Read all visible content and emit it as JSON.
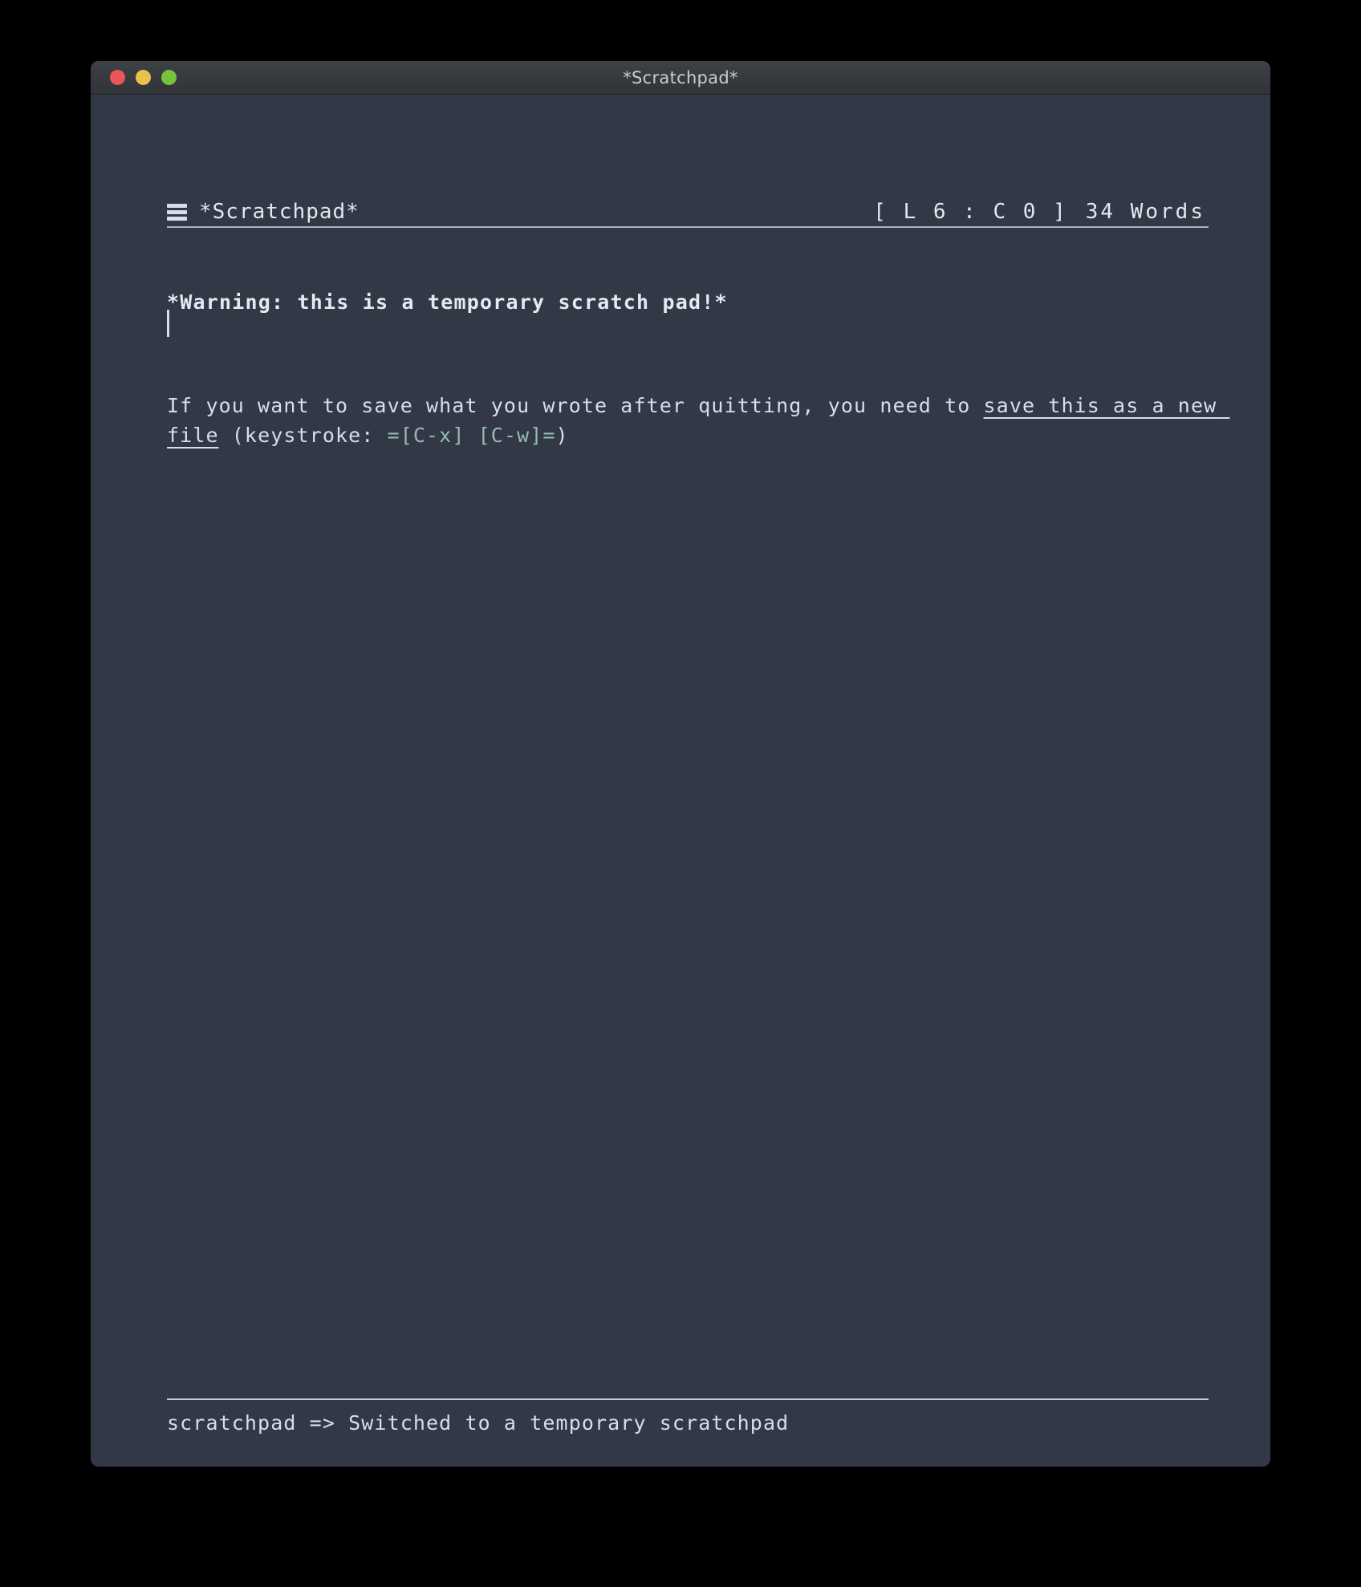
{
  "window": {
    "title": "*Scratchpad*",
    "controls": [
      {
        "name": "close",
        "label": "close",
        "color": "#e8565a"
      },
      {
        "name": "minimize",
        "label": "minimize",
        "color": "#e8c04b"
      },
      {
        "name": "zoom",
        "label": "zoom",
        "color": "#76c33e"
      }
    ],
    "titlebar_bg": "#383c41",
    "body_bg": "#323846",
    "text_color": "#d8dee9"
  },
  "header": {
    "menu_icon": "hamburger-icon",
    "buffer_name": "*Scratchpad*",
    "position": "[ L 6 : C 0 ]",
    "word_count": "34 Words"
  },
  "document": {
    "warning": "*Warning: this is a temporary scratch pad!*",
    "paragraph": {
      "part1": "If you want to save what you wrote after quitting, you need to ",
      "link": "save this as a new file",
      "part2": " (keystroke: ",
      "code": "=[C-x] [C-w]=",
      "part3": ")"
    },
    "cursor_line": 6,
    "cursor_column": 0
  },
  "echo_area": {
    "message": "scratchpad => Switched to a temporary scratchpad"
  },
  "colors": {
    "accent_code": "#96b9b4",
    "rule": "#c3cad8",
    "background": "#323846"
  }
}
